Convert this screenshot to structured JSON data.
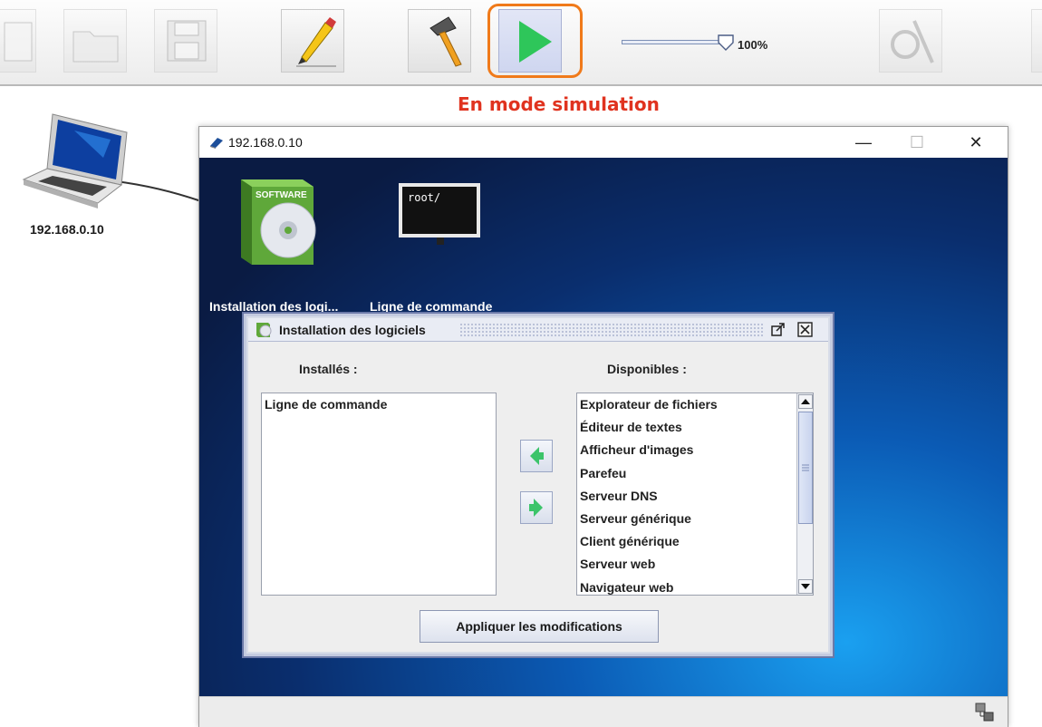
{
  "toolbar": {
    "zoom_label": "100%",
    "mode_label": "En mode simulation"
  },
  "canvas": {
    "device_label": "192.168.0.10"
  },
  "sim_window": {
    "title": "192.168.0.10",
    "minimize_glyph": "—",
    "maximize_glyph": "☐",
    "close_glyph": "✕",
    "desktop_icons": [
      {
        "label": "Installation des logi...",
        "icon": "software-cd-icon"
      },
      {
        "label": "Ligne de commande",
        "icon": "terminal-icon",
        "screen_text": "root/"
      }
    ],
    "software_box_text": "SOFTWARE"
  },
  "install_frame": {
    "title": "Installation des logiciels",
    "installed_header": "Installés :",
    "available_header": "Disponibles :",
    "installed": [
      "Ligne de commande"
    ],
    "available": [
      "Explorateur de fichiers",
      "Éditeur de textes",
      "Afficheur d'images",
      "Parefeu",
      "Serveur DNS",
      "Serveur générique",
      "Client générique",
      "Serveur web",
      "Navigateur web"
    ],
    "apply_label": "Appliquer les modifications"
  },
  "colors": {
    "mode_label": "#e0331f",
    "play_highlight": "#f07a1a",
    "play_icon": "#2ec65a"
  }
}
